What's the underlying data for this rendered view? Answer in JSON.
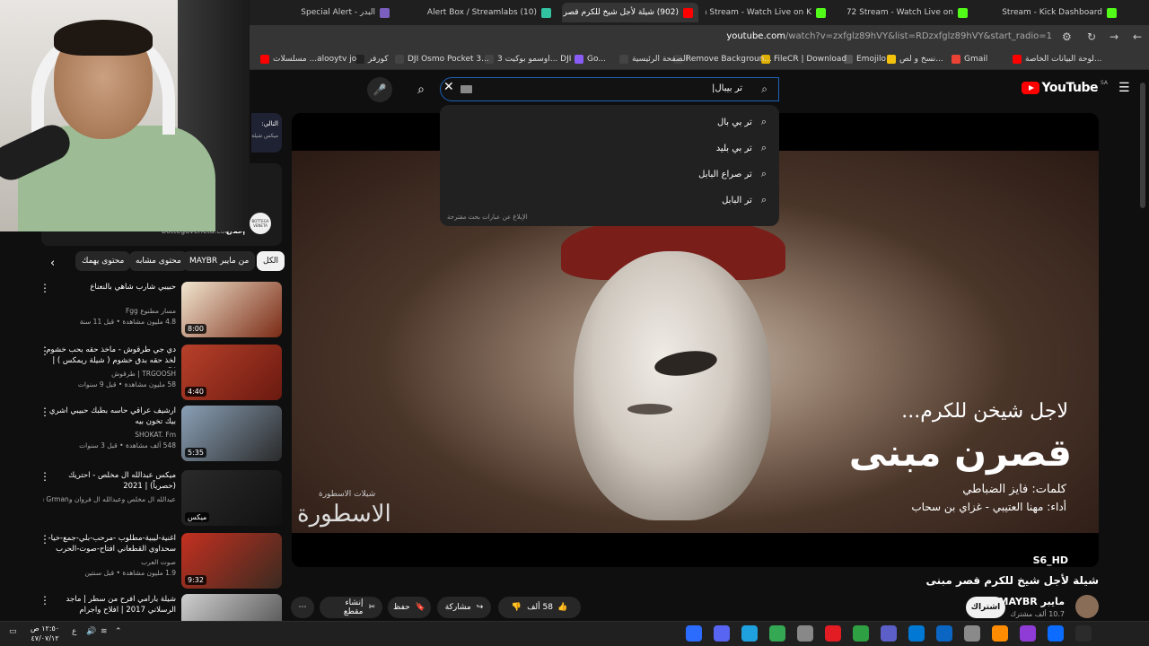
{
  "browser": {
    "tabs": [
      {
        "label": "البدر - Special Alert",
        "color": "#7a5fbf"
      },
      {
        "label": "(10) Alert Box / Streamlabs",
        "color": "#31c3a2"
      },
      {
        "label": "(902) شيلة لأجل شيخ للكرم قصر",
        "color": "#ff0000"
      },
      {
        "label": "IlYzn Stream - Watch Live on K",
        "color": "#53fc18"
      },
      {
        "label": "SLN72 Stream - Watch Live on",
        "color": "#53fc18"
      },
      {
        "label": "Stream - Kick Dashboard",
        "color": "#53fc18"
      }
    ],
    "url_host": "youtube.com",
    "url_path": "/watch?v=zxfglz89hVY&list=RDzxfglz89hVY&start_radio=1",
    "bookmarks": [
      {
        "label": "لوحة البيانات الخاصة...",
        "color": "#ff0000"
      },
      {
        "label": "Gmail",
        "color": "#ea4335"
      },
      {
        "label": "نسخ و لص...",
        "color": "#f4c20d"
      },
      {
        "label": "Emojilo",
        "color": "#555555"
      },
      {
        "label": "FileCR | Download",
        "color": "#e0b000"
      },
      {
        "label": "Remove Backgroun...",
        "color": "#444444"
      },
      {
        "label": "الصفحة الرئيسية",
        "color": "#444444"
      },
      {
        "label": "Go...",
        "color": "#8a5cf6"
      },
      {
        "label": "اوسمو بوكيت 3... DJI",
        "color": "#444444"
      },
      {
        "label": "DJI Osmo Pocket 3...",
        "color": "#444444"
      },
      {
        "label": "كورفر",
        "color": "#222222"
      },
      {
        "label": "مسلسلات ...alooytv jo",
        "color": "#ff0000"
      }
    ]
  },
  "youtube": {
    "logo_text": "YouTube",
    "logo_region": "SA",
    "search": {
      "value": "تر بيبال|",
      "suggestions": [
        "تر بي بال",
        "تر بي بليد",
        "تر صراع البابل",
        "تر البابل"
      ],
      "report_text": "الإبلاغ عن عبارات بحث مقترحة"
    },
    "player": {
      "overlay_line1": "لاجل شيخن للكرم...",
      "overlay_line2": "قصرن مبنى",
      "overlay_credit1": "كلمات: فايز الضباطي",
      "overlay_credit2": "أداء: مهنا العتيبي - غزاي بن سحاب",
      "overlay_brand": "الاسطورة",
      "overlay_brand_sub": "شيلات الاسطورة",
      "overlay_handle": "S6_HD"
    },
    "video": {
      "title": "شيلة لأجل شيخ للكرم قصر مبنى",
      "channel": "مايبر MAYBR",
      "subscribers": "10.7 ألف مشترك",
      "subscribe_label": "اشتراك",
      "likes": "58 ألف",
      "share_label": "مشاركة",
      "save_label": "حفظ",
      "clip_label": "إنشاء مقطع"
    },
    "sidebar": {
      "next_label": "التالي:",
      "next_sub": "ميكس شيلة",
      "ad_label": "إعلان",
      "ad_domain": "bottegaveneta.com",
      "ad_logo": "BOTTEGA VENETA",
      "chips": [
        "الكل",
        "من مايبر MAYBR",
        "محتوى مشابه",
        "محتوى يهمك"
      ],
      "recommendations": [
        {
          "title": "حبيبي شارب شاهي بالنعناع",
          "channel": "مسار مطنوع Fgg",
          "meta": "4.8 مليون مشاهدة • قبل 11 سنة",
          "duration": "8:00",
          "colors": [
            "#f2e6d0",
            "#7a2a14"
          ]
        },
        {
          "title": "دي جي طرقوش - ماخذ حقه بحب خشوم لخذ حقه بدق خشوم ( شيلة ريمكس ) | DJ ...",
          "channel": "TRGOOSH | طرقوش",
          "meta": "58 مليون مشاهدة • قبل 9 سنوات",
          "duration": "4:40",
          "colors": [
            "#b8402a",
            "#6a1a10"
          ]
        },
        {
          "title": "ارشيف عراقي حاسه بطبك حبيبي اشري بيك تخون بيه",
          "channel": "SHOKAT. Fm",
          "meta": "548 ألف مشاهدة • قبل 3 سنوات",
          "duration": "5:35",
          "colors": [
            "#8aa0b6",
            "#2a2a2a"
          ]
        },
        {
          "title": "ميكس عبدالله ال مخلص - احتريك (حصرياً) | 2021",
          "channel": "عبدالله ال مخلص وعبدالله ال فروان وBin Grman...",
          "meta": "",
          "duration": "ميكس",
          "colors": [
            "#2a2a2a",
            "#111111"
          ]
        },
        {
          "title": "اغنية-ليبية-مطلوب -مرحب-بلي-جمع-خيا- سحداوي القطعاني افتاح-صوت-الحرب",
          "channel": "صوت العرب",
          "meta": "1.9 مليون مشاهدة • قبل سنتين",
          "duration": "9:32",
          "colors": [
            "#c43020",
            "#3a2a20"
          ]
        },
        {
          "title": "شيلة بارامي افرح من سطر | ماجد الرسلاني 2017 | افلاح واجرام",
          "channel": "",
          "meta": "",
          "duration": "",
          "colors": [
            "#cfcfcf",
            "#444444"
          ]
        }
      ]
    }
  },
  "taskbar": {
    "time": "١٢:٥٠ ص",
    "date": "٤٧/٠٧/١٢",
    "lang": "ع",
    "apps": [
      "#2b6cff",
      "#5865f2",
      "#1fa1e0",
      "#34a853",
      "#888888",
      "#e31b23",
      "#2ea043",
      "#5b5fc7",
      "#0078d4",
      "#0a66c2",
      "#8a8a8a",
      "#ff8c00",
      "#8f3bd6",
      "#0b6cff",
      "#2b2b2b"
    ]
  }
}
